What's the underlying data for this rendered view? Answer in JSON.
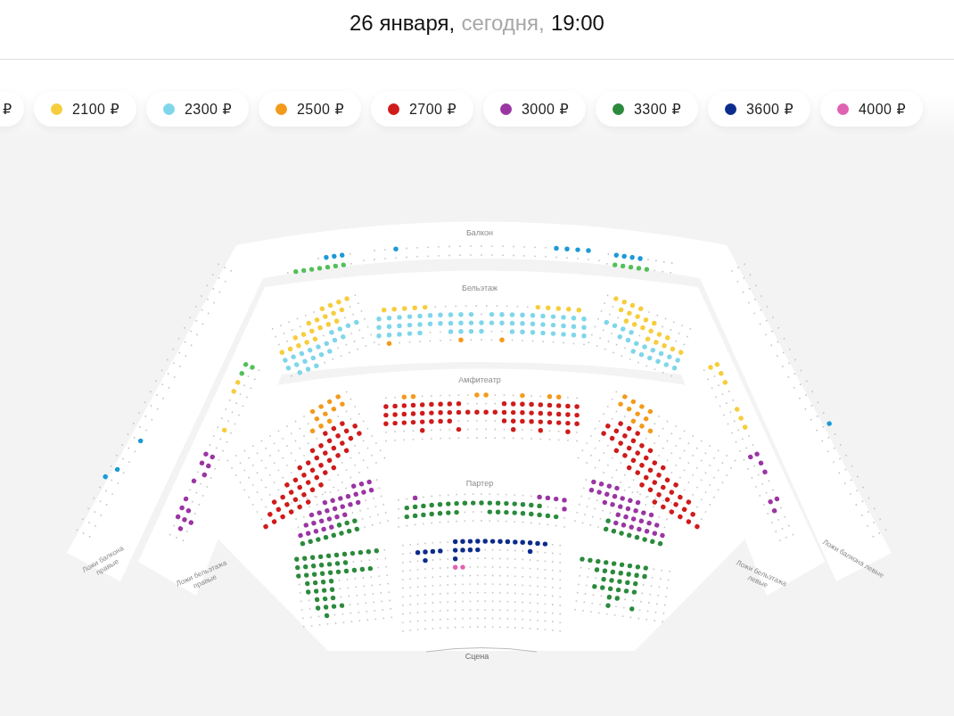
{
  "header": {
    "date": "26 января,",
    "day": "сегодня,",
    "time": "19:00"
  },
  "prices": [
    {
      "label": "₽"
    },
    {
      "label": "2100 ₽",
      "color": "#f6cd3c"
    },
    {
      "label": "2300 ₽",
      "color": "#7fd6ea"
    },
    {
      "label": "2500 ₽",
      "color": "#f39a1c"
    },
    {
      "label": "2700 ₽",
      "color": "#cf1b1b"
    },
    {
      "label": "3000 ₽",
      "color": "#9a35a3"
    },
    {
      "label": "3300 ₽",
      "color": "#2b8a3c"
    },
    {
      "label": "3600 ₽",
      "color": "#0b2c8c"
    },
    {
      "label": "4000 ₽",
      "color": "#e062b2"
    }
  ],
  "sections": [
    {
      "name": "Балкон"
    },
    {
      "name": "Бельэтаж"
    },
    {
      "name": "Амфитеатр"
    },
    {
      "name": "Партер"
    }
  ],
  "boxes": [
    {
      "name": "Ложи балкона правые"
    },
    {
      "name": "Ложи бельэтажа правые"
    },
    {
      "name": "Ложи бельэтажа левые"
    },
    {
      "name": "Ложи балкона левые"
    }
  ],
  "stage": "Сцена"
}
